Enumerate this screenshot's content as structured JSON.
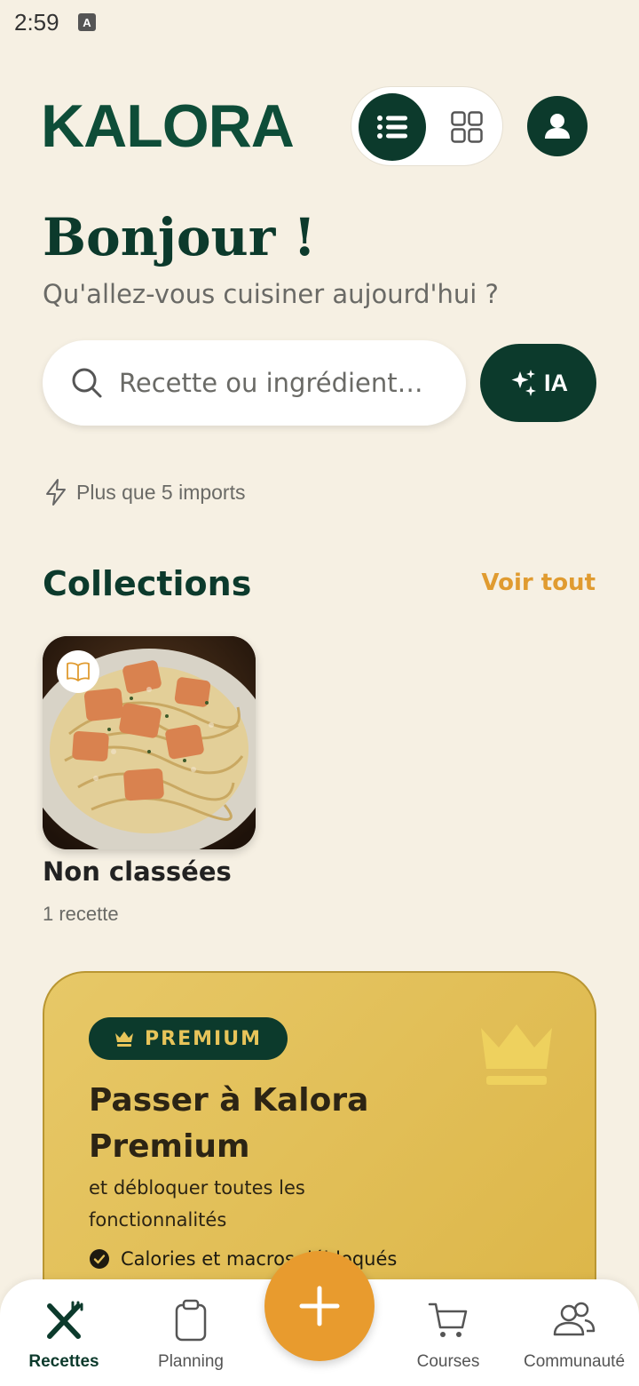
{
  "status_bar": {
    "time": "2:59",
    "indicator": "A"
  },
  "header": {
    "logo": "KALORA",
    "view_toggle": {
      "active": "list",
      "options": [
        "list-icon",
        "grid-icon"
      ]
    },
    "profile_icon": "user-icon"
  },
  "greeting": {
    "title": "Bonjour !",
    "subtitle": "Qu'allez-vous cuisiner aujourd'hui ?"
  },
  "search": {
    "placeholder": "Recette ou ingrédient…",
    "value": "",
    "ai_button_label": "IA"
  },
  "imports_notice": "Plus que 5 imports",
  "collections": {
    "title": "Collections",
    "see_all": "Voir tout",
    "items": [
      {
        "name": "Non classées",
        "count": "1 recette",
        "image": "salmon-pasta-photo"
      }
    ]
  },
  "premium": {
    "badge": "PREMIUM",
    "title": "Passer à Kalora Premium",
    "subtitle": "et débloquer toutes les fonctionnalités",
    "features": [
      "Calories et macros débloqués"
    ]
  },
  "bottom_nav": {
    "items": [
      {
        "label": "Recettes",
        "icon": "utensils-icon",
        "active": true
      },
      {
        "label": "Planning",
        "icon": "clipboard-icon",
        "active": false
      },
      {
        "label": "Courses",
        "icon": "cart-icon",
        "active": false
      },
      {
        "label": "Communauté",
        "icon": "users-icon",
        "active": false
      }
    ],
    "fab_icon": "plus-icon"
  },
  "colors": {
    "background": "#f6f0e3",
    "brand_green": "#0c3a2c",
    "accent_orange": "#e89b2e",
    "premium_gold": "#e2bf58"
  }
}
